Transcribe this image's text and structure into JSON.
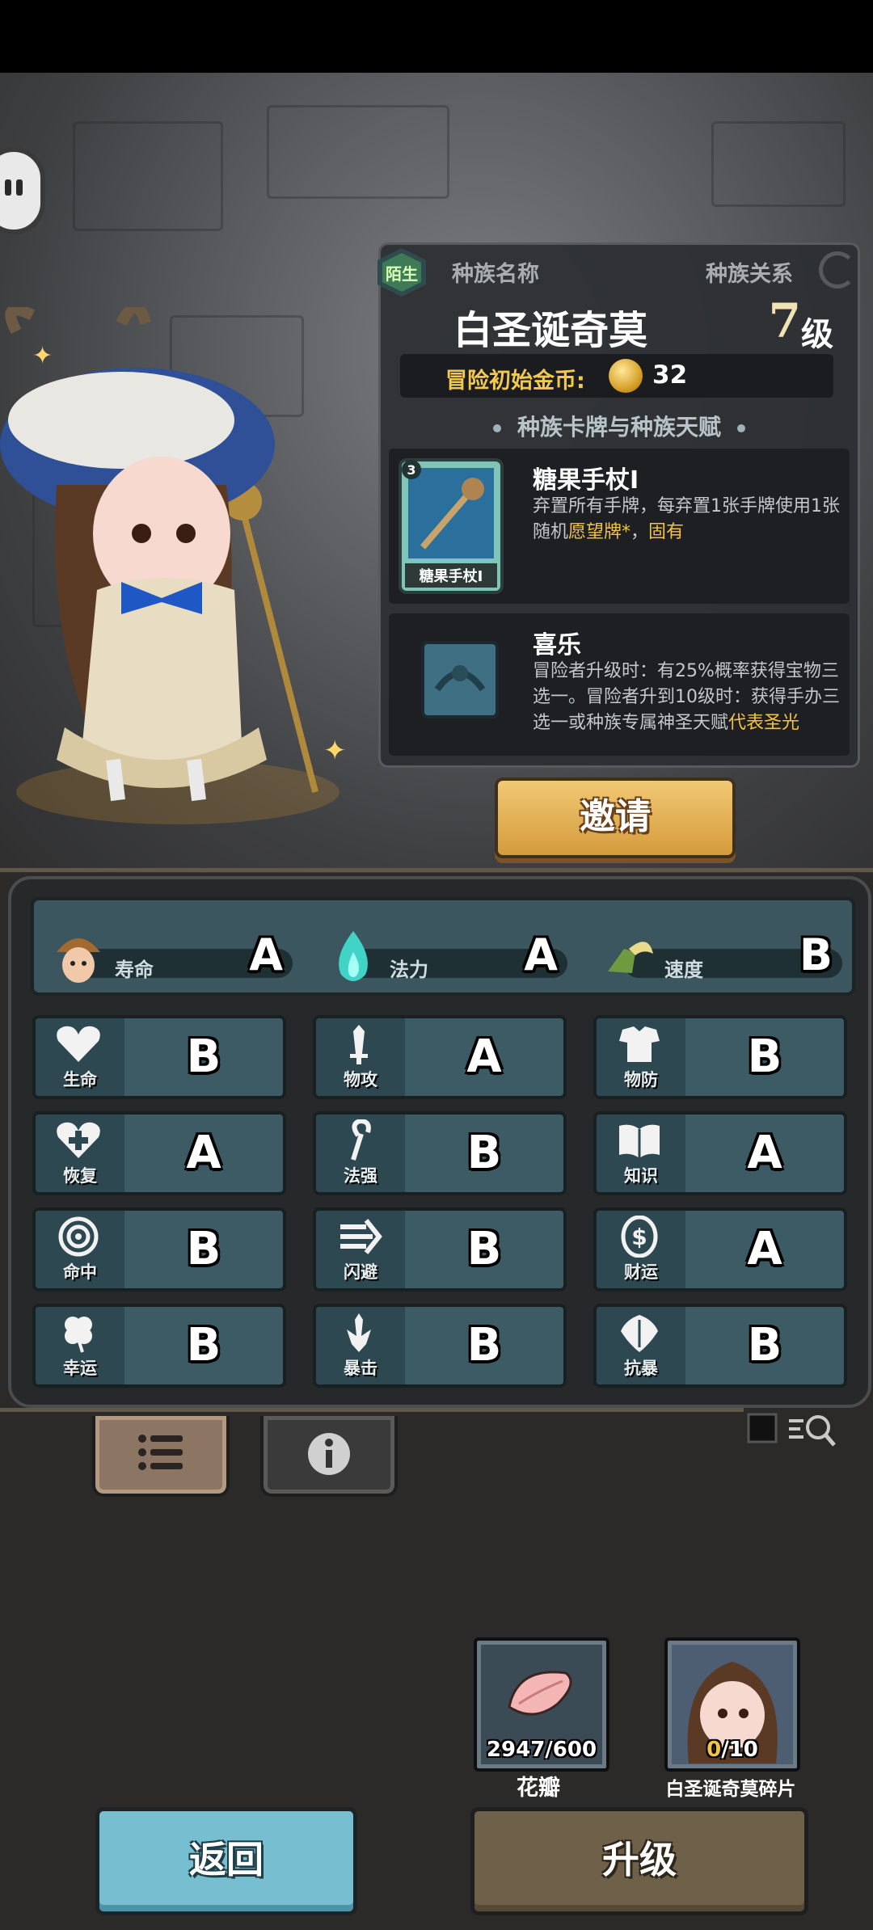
{
  "race_info": {
    "tag": "陌生",
    "race_name_label": "种族名称",
    "race_relation_label": "种族关系",
    "character_name": "白圣诞奇莫",
    "level": "7",
    "level_unit": "级",
    "start_gold_label": "冒险初始金币:",
    "start_gold_value": "32",
    "section_title": "种族卡牌与种族天赋"
  },
  "card": {
    "cost": "3",
    "card_label": "糖果手杖I",
    "name": "糖果手杖I",
    "desc_plain": "弃置所有手牌，每弃置1张手牌使用1张随机",
    "desc_highlight_1": "愿望牌*",
    "desc_sep": "，",
    "desc_highlight_2": "固有"
  },
  "talent": {
    "name": "喜乐",
    "desc_plain": "冒险者升级时：有25%概率获得宝物三选一。冒险者升到10级时：获得手办三选一或种族专属神圣天赋",
    "desc_highlight": "代表圣光"
  },
  "invite_label": "邀请",
  "main_attrs": [
    {
      "label": "寿命",
      "grade": "A",
      "icon": "mushroom-head-icon"
    },
    {
      "label": "法力",
      "grade": "A",
      "icon": "blue-flame-icon"
    },
    {
      "label": "速度",
      "grade": "B",
      "icon": "winged-boot-icon"
    }
  ],
  "stats": [
    {
      "label": "生命",
      "grade": "B",
      "icon": "heart-icon"
    },
    {
      "label": "物攻",
      "grade": "A",
      "icon": "sword-icon"
    },
    {
      "label": "物防",
      "grade": "B",
      "icon": "armor-icon"
    },
    {
      "label": "恢复",
      "grade": "A",
      "icon": "heart-plus-icon"
    },
    {
      "label": "法强",
      "grade": "B",
      "icon": "staff-icon"
    },
    {
      "label": "知识",
      "grade": "A",
      "icon": "book-icon"
    },
    {
      "label": "命中",
      "grade": "B",
      "icon": "target-icon"
    },
    {
      "label": "闪避",
      "grade": "B",
      "icon": "dodge-arrows-icon"
    },
    {
      "label": "财运",
      "grade": "A",
      "icon": "coin-icon"
    },
    {
      "label": "幸运",
      "grade": "B",
      "icon": "clover-icon"
    },
    {
      "label": "暴击",
      "grade": "B",
      "icon": "crit-blade-icon"
    },
    {
      "label": "抗暴",
      "grade": "B",
      "icon": "shield-leaf-icon"
    }
  ],
  "resources": [
    {
      "count": "2947/600",
      "name": "花瓣"
    },
    {
      "count_owned": "0",
      "count_needed": "/10",
      "name": "白圣诞奇莫碎片"
    }
  ],
  "buttons": {
    "back": "返回",
    "upgrade": "升级"
  },
  "colors": {
    "gold": "#f3c443",
    "invite": "#e2b25a",
    "back": "#77bfd0",
    "upgrade": "#6e6049"
  }
}
